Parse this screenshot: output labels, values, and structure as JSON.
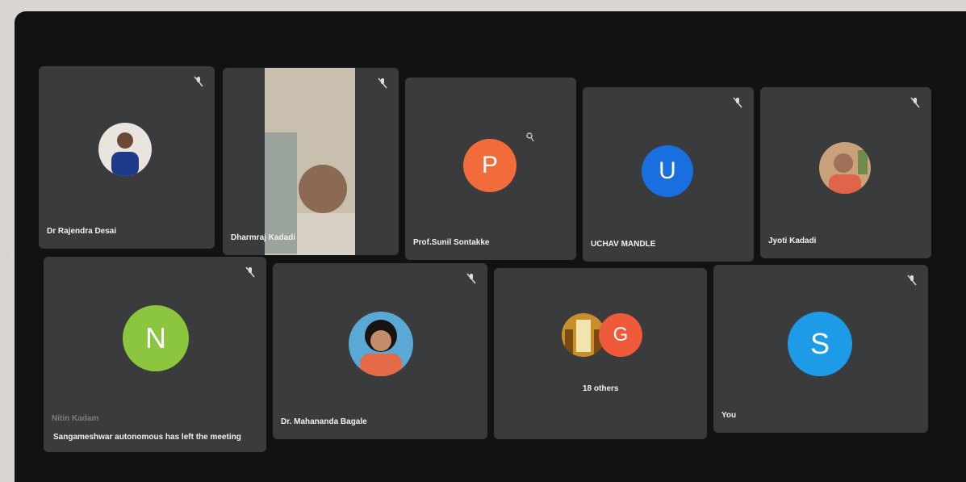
{
  "participants": [
    {
      "name": "Dr Rajendra Desai",
      "avatar": "photo"
    },
    {
      "name": "Dharmraj Kadadi",
      "avatar": "video"
    },
    {
      "name": "Prof.Sunil Sontakke",
      "avatar": "letter",
      "letter": "P",
      "color": "#f26b3a"
    },
    {
      "name": "UCHAV MANDLE",
      "avatar": "letter",
      "letter": "U",
      "color": "#1a6fe0"
    },
    {
      "name": "Jyoti Kadadi",
      "avatar": "photo"
    },
    {
      "name": "Nitin Kadam",
      "avatar": "letter",
      "letter": "N",
      "color": "#8cc63f"
    },
    {
      "name": "Dr. Mahananda Bagale",
      "avatar": "photo"
    },
    {
      "name": "You",
      "avatar": "letter",
      "letter": "S",
      "color": "#1e9be6"
    }
  ],
  "others": {
    "label": "18 others",
    "letter": "G",
    "color": "#ee5a3a"
  },
  "notification": "Sangameshwar autonomous has left the meeting",
  "icons": {
    "mic": "mic-off-icon",
    "nav": "chevron-left-icon"
  }
}
